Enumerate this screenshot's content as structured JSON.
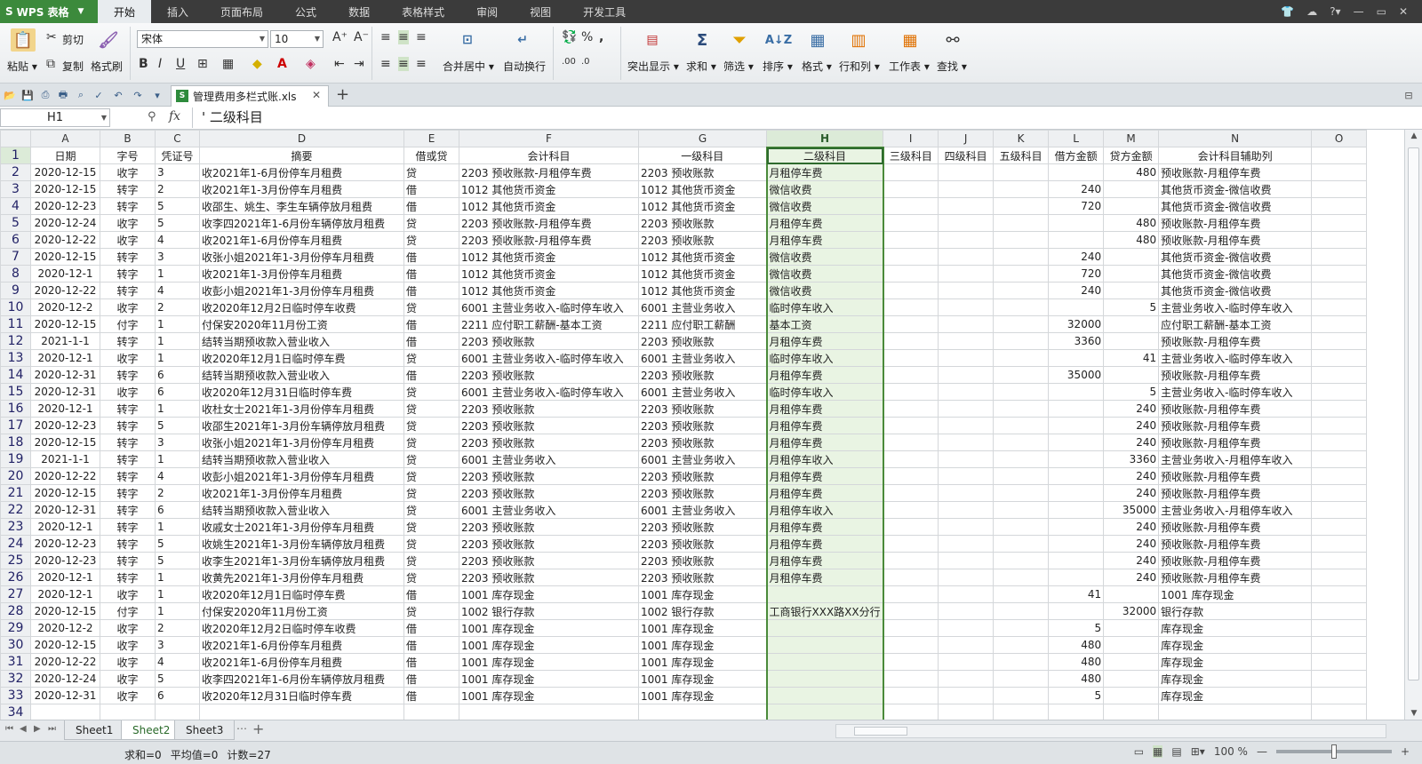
{
  "app": {
    "name": "WPS 表格"
  },
  "menu": [
    "开始",
    "插入",
    "页面布局",
    "公式",
    "数据",
    "表格样式",
    "审阅",
    "视图",
    "开发工具"
  ],
  "active_menu": "开始",
  "ribbon": {
    "paste": "粘贴",
    "cut": "剪切",
    "copy": "复制",
    "format_painter": "格式刷",
    "font_name": "宋体",
    "font_size": "10",
    "merge_center": "合并居中",
    "wrap_text": "自动换行",
    "highlight": "突出显示",
    "sum": "求和",
    "filter": "筛选",
    "sort": "排序",
    "format": "格式",
    "rows_cols": "行和列",
    "worksheet": "工作表",
    "find": "查找"
  },
  "document_tab": {
    "filename": "管理费用多栏式账.xls"
  },
  "formula_bar": {
    "cell_ref": "H1",
    "fx": "fx",
    "content": "' 二级科目"
  },
  "columns": [
    "A",
    "B",
    "C",
    "D",
    "E",
    "F",
    "G",
    "H",
    "I",
    "J",
    "K",
    "L",
    "M",
    "N",
    "O"
  ],
  "headers": [
    "日期",
    "字号",
    "凭证号",
    "摘要",
    "借或贷",
    "会计科目",
    "一级科目",
    "二级科目",
    "三级科目",
    "四级科目",
    "五级科目",
    "借方金额",
    "贷方金额",
    "会计科目辅助列",
    ""
  ],
  "rows": [
    [
      "2020-12-15",
      "收字",
      "3",
      "收2021年1-6月份停车月租费",
      "贷",
      "2203 预收账款-月租停车费",
      "2203 预收账款",
      "月租停车费",
      "",
      "",
      "",
      "",
      "480",
      "预收账款-月租停车费",
      ""
    ],
    [
      "2020-12-15",
      "转字",
      "2",
      "收2021年1-3月份停车月租费",
      "借",
      "1012 其他货币资金",
      "1012 其他货币资金",
      "微信收费",
      "",
      "",
      "",
      "240",
      "",
      "其他货币资金-微信收费",
      ""
    ],
    [
      "2020-12-23",
      "转字",
      "5",
      "收邵生、姚生、李生车辆停放月租费",
      "借",
      "1012 其他货币资金",
      "1012 其他货币资金",
      "微信收费",
      "",
      "",
      "",
      "720",
      "",
      "其他货币资金-微信收费",
      ""
    ],
    [
      "2020-12-24",
      "收字",
      "5",
      "收李四2021年1-6月份车辆停放月租费",
      "贷",
      "2203 预收账款-月租停车费",
      "2203 预收账款",
      "月租停车费",
      "",
      "",
      "",
      "",
      "480",
      "预收账款-月租停车费",
      ""
    ],
    [
      "2020-12-22",
      "收字",
      "4",
      "收2021年1-6月份停车月租费",
      "贷",
      "2203 预收账款-月租停车费",
      "2203 预收账款",
      "月租停车费",
      "",
      "",
      "",
      "",
      "480",
      "预收账款-月租停车费",
      ""
    ],
    [
      "2020-12-15",
      "转字",
      "3",
      "收张小姐2021年1-3月份停车月租费",
      "借",
      "1012 其他货币资金",
      "1012 其他货币资金",
      "微信收费",
      "",
      "",
      "",
      "240",
      "",
      "其他货币资金-微信收费",
      ""
    ],
    [
      "2020-12-1",
      "转字",
      "1",
      "收2021年1-3月份停车月租费",
      "借",
      "1012 其他货币资金",
      "1012 其他货币资金",
      "微信收费",
      "",
      "",
      "",
      "720",
      "",
      "其他货币资金-微信收费",
      ""
    ],
    [
      "2020-12-22",
      "转字",
      "4",
      "收彭小姐2021年1-3月份停车月租费",
      "借",
      "1012 其他货币资金",
      "1012 其他货币资金",
      "微信收费",
      "",
      "",
      "",
      "240",
      "",
      "其他货币资金-微信收费",
      ""
    ],
    [
      "2020-12-2",
      "收字",
      "2",
      "收2020年12月2日临时停车收费",
      "贷",
      "6001 主营业务收入-临时停车收入",
      "6001 主营业务收入",
      "临时停车收入",
      "",
      "",
      "",
      "",
      "5",
      "主营业务收入-临时停车收入",
      ""
    ],
    [
      "2020-12-15",
      "付字",
      "1",
      "付保安2020年11月份工资",
      "借",
      "2211 应付职工薪酬-基本工资",
      "2211 应付职工薪酬",
      "基本工资",
      "",
      "",
      "",
      "32000",
      "",
      "应付职工薪酬-基本工资",
      ""
    ],
    [
      "2021-1-1",
      "转字",
      "1",
      "结转当期预收款入营业收入",
      "借",
      "2203 预收账款",
      "2203 预收账款",
      "月租停车费",
      "",
      "",
      "",
      "3360",
      "",
      "预收账款-月租停车费",
      ""
    ],
    [
      "2020-12-1",
      "收字",
      "1",
      "收2020年12月1日临时停车费",
      "贷",
      "6001 主营业务收入-临时停车收入",
      "6001 主营业务收入",
      "临时停车收入",
      "",
      "",
      "",
      "",
      "41",
      "主营业务收入-临时停车收入",
      ""
    ],
    [
      "2020-12-31",
      "转字",
      "6",
      "结转当期预收款入营业收入",
      "借",
      "2203 预收账款",
      "2203 预收账款",
      "月租停车费",
      "",
      "",
      "",
      "35000",
      "",
      "预收账款-月租停车费",
      ""
    ],
    [
      "2020-12-31",
      "收字",
      "6",
      "收2020年12月31日临时停车费",
      "贷",
      "6001 主营业务收入-临时停车收入",
      "6001 主营业务收入",
      "临时停车收入",
      "",
      "",
      "",
      "",
      "5",
      "主营业务收入-临时停车收入",
      ""
    ],
    [
      "2020-12-1",
      "转字",
      "1",
      "收杜女士2021年1-3月份停车月租费",
      "贷",
      "2203 预收账款",
      "2203 预收账款",
      "月租停车费",
      "",
      "",
      "",
      "",
      "240",
      "预收账款-月租停车费",
      ""
    ],
    [
      "2020-12-23",
      "转字",
      "5",
      "收邵生2021年1-3月份车辆停放月租费",
      "贷",
      "2203 预收账款",
      "2203 预收账款",
      "月租停车费",
      "",
      "",
      "",
      "",
      "240",
      "预收账款-月租停车费",
      ""
    ],
    [
      "2020-12-15",
      "转字",
      "3",
      "收张小姐2021年1-3月份停车月租费",
      "贷",
      "2203 预收账款",
      "2203 预收账款",
      "月租停车费",
      "",
      "",
      "",
      "",
      "240",
      "预收账款-月租停车费",
      ""
    ],
    [
      "2021-1-1",
      "转字",
      "1",
      "结转当期预收款入营业收入",
      "贷",
      "6001 主营业务收入",
      "6001 主营业务收入",
      "月租停车收入",
      "",
      "",
      "",
      "",
      "3360",
      "主营业务收入-月租停车收入",
      ""
    ],
    [
      "2020-12-22",
      "转字",
      "4",
      "收彭小姐2021年1-3月份停车月租费",
      "贷",
      "2203 预收账款",
      "2203 预收账款",
      "月租停车费",
      "",
      "",
      "",
      "",
      "240",
      "预收账款-月租停车费",
      ""
    ],
    [
      "2020-12-15",
      "转字",
      "2",
      "收2021年1-3月份停车月租费",
      "贷",
      "2203 预收账款",
      "2203 预收账款",
      "月租停车费",
      "",
      "",
      "",
      "",
      "240",
      "预收账款-月租停车费",
      ""
    ],
    [
      "2020-12-31",
      "转字",
      "6",
      "结转当期预收款入营业收入",
      "贷",
      "6001 主营业务收入",
      "6001 主营业务收入",
      "月租停车收入",
      "",
      "",
      "",
      "",
      "35000",
      "主营业务收入-月租停车收入",
      ""
    ],
    [
      "2020-12-1",
      "转字",
      "1",
      "收戚女士2021年1-3月份停车月租费",
      "贷",
      "2203 预收账款",
      "2203 预收账款",
      "月租停车费",
      "",
      "",
      "",
      "",
      "240",
      "预收账款-月租停车费",
      ""
    ],
    [
      "2020-12-23",
      "转字",
      "5",
      "收姚生2021年1-3月份车辆停放月租费",
      "贷",
      "2203 预收账款",
      "2203 预收账款",
      "月租停车费",
      "",
      "",
      "",
      "",
      "240",
      "预收账款-月租停车费",
      ""
    ],
    [
      "2020-12-23",
      "转字",
      "5",
      "收李生2021年1-3月份车辆停放月租费",
      "贷",
      "2203 预收账款",
      "2203 预收账款",
      "月租停车费",
      "",
      "",
      "",
      "",
      "240",
      "预收账款-月租停车费",
      ""
    ],
    [
      "2020-12-1",
      "转字",
      "1",
      "收黄先2021年1-3月份停车月租费",
      "贷",
      "2203 预收账款",
      "2203 预收账款",
      "月租停车费",
      "",
      "",
      "",
      "",
      "240",
      "预收账款-月租停车费",
      ""
    ],
    [
      "2020-12-1",
      "收字",
      "1",
      "收2020年12月1日临时停车费",
      "借",
      "1001 库存现金",
      "1001 库存现金",
      "",
      "",
      "",
      "",
      "41",
      "",
      "1001 库存现金",
      ""
    ],
    [
      "2020-12-15",
      "付字",
      "1",
      "付保安2020年11月份工资",
      "贷",
      "1002 银行存款",
      "1002 银行存款",
      "工商银行XXX路XX分行",
      "",
      "",
      "",
      "",
      "32000",
      "银行存款",
      ""
    ],
    [
      "2020-12-2",
      "收字",
      "2",
      "收2020年12月2日临时停车收费",
      "借",
      "1001 库存现金",
      "1001 库存现金",
      "",
      "",
      "",
      "",
      "5",
      "",
      "库存现金",
      ""
    ],
    [
      "2020-12-15",
      "收字",
      "3",
      "收2021年1-6月份停车月租费",
      "借",
      "1001 库存现金",
      "1001 库存现金",
      "",
      "",
      "",
      "",
      "480",
      "",
      "库存现金",
      ""
    ],
    [
      "2020-12-22",
      "收字",
      "4",
      "收2021年1-6月份停车月租费",
      "借",
      "1001 库存现金",
      "1001 库存现金",
      "",
      "",
      "",
      "",
      "480",
      "",
      "库存现金",
      ""
    ],
    [
      "2020-12-24",
      "收字",
      "5",
      "收李四2021年1-6月份车辆停放月租费",
      "借",
      "1001 库存现金",
      "1001 库存现金",
      "",
      "",
      "",
      "",
      "480",
      "",
      "库存现金",
      ""
    ],
    [
      "2020-12-31",
      "收字",
      "6",
      "收2020年12月31日临时停车费",
      "借",
      "1001 库存现金",
      "1001 库存现金",
      "",
      "",
      "",
      "",
      "5",
      "",
      "库存现金",
      ""
    ]
  ],
  "sheets": [
    "Sheet1",
    "Sheet2",
    "Sheet3"
  ],
  "active_sheet": "Sheet2",
  "status": {
    "sum": "求和=0",
    "average": "平均值=0",
    "count": "计数=27",
    "zoom": "100 %"
  },
  "colors": {
    "accent_green": "#4a8a3a",
    "selected_col_fill": "#e9f4e3",
    "titlebar": "#3b3b3b"
  }
}
